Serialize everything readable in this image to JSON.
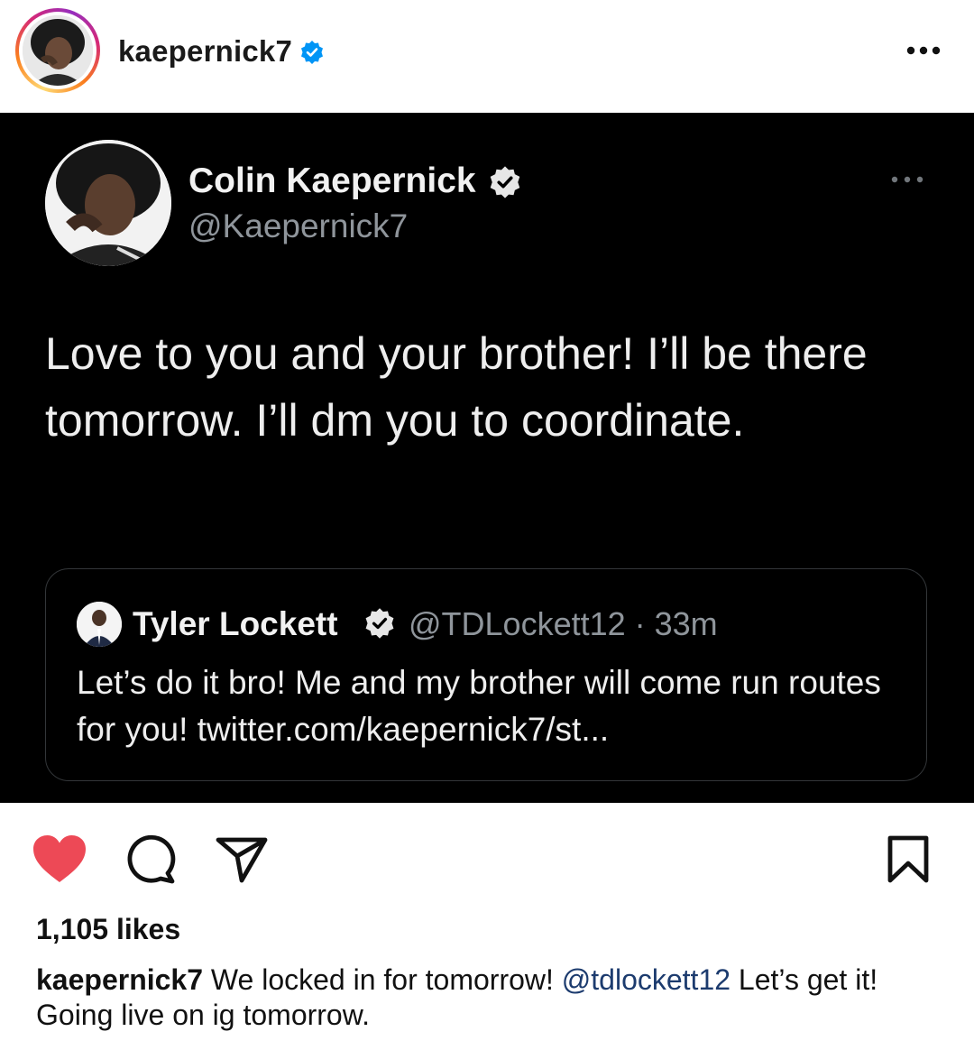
{
  "header": {
    "username": "kaepernick7",
    "verified": true,
    "more_icon": "more-horizontal-icon"
  },
  "tweet": {
    "author_name": "Colin Kaepernick",
    "author_handle": "@Kaepernick7",
    "verified": true,
    "text": "Love to you and your brother! I’ll be there tomorrow. I’ll dm you to coordinate.",
    "quoted": {
      "author_name": "Tyler Lockett",
      "author_handle": "@TDLockett12 · 33m",
      "verified": true,
      "text": "Let’s do it bro! Me and my brother will come run routes for you! twitter.com/kaepernick7/st..."
    }
  },
  "actions": {
    "like_icon": "heart-filled-icon",
    "comment_icon": "comment-icon",
    "share_icon": "send-icon",
    "save_icon": "bookmark-icon"
  },
  "likes": "1,105 likes",
  "caption": {
    "username": "kaepernick7",
    "text_before": " We locked in for tomorrow! ",
    "mention": "@tdlockett12",
    "text_after": " Let’s get it! Going live on ig tomorrow."
  },
  "colors": {
    "verified_blue": "#0095f6",
    "like_red": "#ed4956",
    "tweet_bg": "#000000",
    "mention": "#1c3b6e"
  }
}
